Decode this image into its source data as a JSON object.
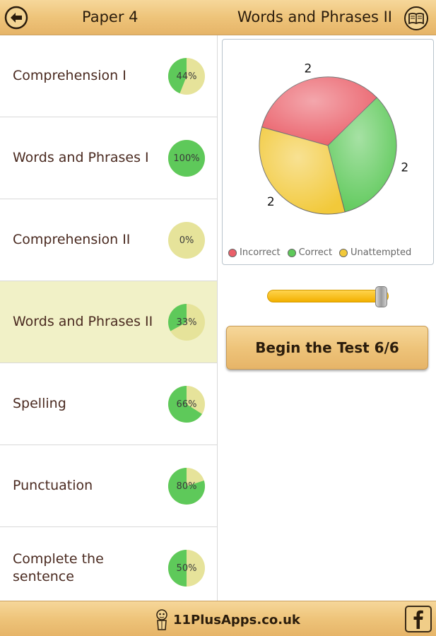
{
  "header": {
    "paper_title": "Paper 4",
    "screen_title": "Words and Phrases II"
  },
  "topics": [
    {
      "label": "Comprehension I",
      "percent": 44,
      "percent_text": "44%",
      "selected": false
    },
    {
      "label": "Words and Phrases I",
      "percent": 100,
      "percent_text": "100%",
      "selected": false
    },
    {
      "label": "Comprehension II",
      "percent": 0,
      "percent_text": "0%",
      "selected": false
    },
    {
      "label": "Words and Phrases II",
      "percent": 33,
      "percent_text": "33%",
      "selected": true
    },
    {
      "label": "Spelling",
      "percent": 66,
      "percent_text": "66%",
      "selected": false
    },
    {
      "label": "Punctuation",
      "percent": 80,
      "percent_text": "80%",
      "selected": false
    },
    {
      "label": "Complete the sentence",
      "percent": 50,
      "percent_text": "50%",
      "selected": false
    }
  ],
  "chart_data": {
    "type": "pie",
    "categories": [
      "Incorrect",
      "Correct",
      "Unattempted"
    ],
    "values": [
      2,
      2,
      2
    ],
    "colors": [
      "#ea5f69",
      "#5ec95a",
      "#f2c93a"
    ],
    "data_labels": [
      "2",
      "2",
      "2"
    ],
    "legend_position": "bottom"
  },
  "legend": {
    "incorrect": "Incorrect",
    "correct": "Correct",
    "unattempted": "Unattempted"
  },
  "slider": {
    "value": 6,
    "max": 6
  },
  "begin_button": {
    "label": "Begin the Test 6/6"
  },
  "footer": {
    "brand": "11PlusApps.co.uk"
  },
  "colors": {
    "wood": "#eec47a",
    "selected_row": "#f1f1c7",
    "badge_green": "#5ec95a",
    "badge_cream": "#e6e39a",
    "slider_fill": "#f2b000"
  },
  "icons": {
    "back": "back-arrow-icon",
    "book": "book-icon",
    "mascot": "mascot-icon",
    "facebook": "facebook-icon"
  }
}
